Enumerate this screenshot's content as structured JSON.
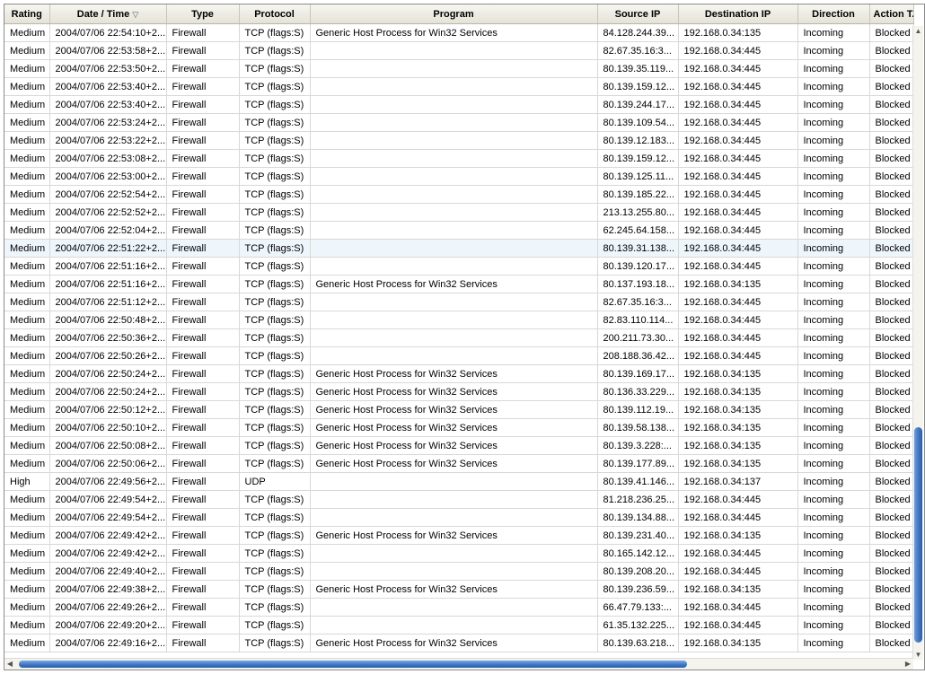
{
  "columns": [
    {
      "key": "rating",
      "label": "Rating"
    },
    {
      "key": "datetime",
      "label": "Date / Time",
      "sort": "▽"
    },
    {
      "key": "type",
      "label": "Type"
    },
    {
      "key": "protocol",
      "label": "Protocol"
    },
    {
      "key": "program",
      "label": "Program"
    },
    {
      "key": "source_ip",
      "label": "Source IP"
    },
    {
      "key": "dest_ip",
      "label": "Destination IP"
    },
    {
      "key": "direction",
      "label": "Direction"
    },
    {
      "key": "action",
      "label": "Action T..."
    }
  ],
  "rows": [
    [
      "Medium",
      "2004/07/06 22:54:10+2...",
      "Firewall",
      "TCP (flags:S)",
      "Generic Host Process for Win32 Services",
      "84.128.244.39...",
      "192.168.0.34:135",
      "Incoming",
      "Blocked"
    ],
    [
      "Medium",
      "2004/07/06 22:53:58+2...",
      "Firewall",
      "TCP (flags:S)",
      "",
      "82.67.35.16:3...",
      "192.168.0.34:445",
      "Incoming",
      "Blocked"
    ],
    [
      "Medium",
      "2004/07/06 22:53:50+2...",
      "Firewall",
      "TCP (flags:S)",
      "",
      "80.139.35.119...",
      "192.168.0.34:445",
      "Incoming",
      "Blocked"
    ],
    [
      "Medium",
      "2004/07/06 22:53:40+2...",
      "Firewall",
      "TCP (flags:S)",
      "",
      "80.139.159.12...",
      "192.168.0.34:445",
      "Incoming",
      "Blocked"
    ],
    [
      "Medium",
      "2004/07/06 22:53:40+2...",
      "Firewall",
      "TCP (flags:S)",
      "",
      "80.139.244.17...",
      "192.168.0.34:445",
      "Incoming",
      "Blocked"
    ],
    [
      "Medium",
      "2004/07/06 22:53:24+2...",
      "Firewall",
      "TCP (flags:S)",
      "",
      "80.139.109.54...",
      "192.168.0.34:445",
      "Incoming",
      "Blocked"
    ],
    [
      "Medium",
      "2004/07/06 22:53:22+2...",
      "Firewall",
      "TCP (flags:S)",
      "",
      "80.139.12.183...",
      "192.168.0.34:445",
      "Incoming",
      "Blocked"
    ],
    [
      "Medium",
      "2004/07/06 22:53:08+2...",
      "Firewall",
      "TCP (flags:S)",
      "",
      "80.139.159.12...",
      "192.168.0.34:445",
      "Incoming",
      "Blocked"
    ],
    [
      "Medium",
      "2004/07/06 22:53:00+2...",
      "Firewall",
      "TCP (flags:S)",
      "",
      "80.139.125.11...",
      "192.168.0.34:445",
      "Incoming",
      "Blocked"
    ],
    [
      "Medium",
      "2004/07/06 22:52:54+2...",
      "Firewall",
      "TCP (flags:S)",
      "",
      "80.139.185.22...",
      "192.168.0.34:445",
      "Incoming",
      "Blocked"
    ],
    [
      "Medium",
      "2004/07/06 22:52:52+2...",
      "Firewall",
      "TCP (flags:S)",
      "",
      "213.13.255.80...",
      "192.168.0.34:445",
      "Incoming",
      "Blocked"
    ],
    [
      "Medium",
      "2004/07/06 22:52:04+2...",
      "Firewall",
      "TCP (flags:S)",
      "",
      "62.245.64.158...",
      "192.168.0.34:445",
      "Incoming",
      "Blocked"
    ],
    [
      "Medium",
      "2004/07/06 22:51:22+2...",
      "Firewall",
      "TCP (flags:S)",
      "",
      "80.139.31.138...",
      "192.168.0.34:445",
      "Incoming",
      "Blocked"
    ],
    [
      "Medium",
      "2004/07/06 22:51:16+2...",
      "Firewall",
      "TCP (flags:S)",
      "",
      "80.139.120.17...",
      "192.168.0.34:445",
      "Incoming",
      "Blocked"
    ],
    [
      "Medium",
      "2004/07/06 22:51:16+2...",
      "Firewall",
      "TCP (flags:S)",
      "Generic Host Process for Win32 Services",
      "80.137.193.18...",
      "192.168.0.34:135",
      "Incoming",
      "Blocked"
    ],
    [
      "Medium",
      "2004/07/06 22:51:12+2...",
      "Firewall",
      "TCP (flags:S)",
      "",
      "82.67.35.16:3...",
      "192.168.0.34:445",
      "Incoming",
      "Blocked"
    ],
    [
      "Medium",
      "2004/07/06 22:50:48+2...",
      "Firewall",
      "TCP (flags:S)",
      "",
      "82.83.110.114...",
      "192.168.0.34:445",
      "Incoming",
      "Blocked"
    ],
    [
      "Medium",
      "2004/07/06 22:50:36+2...",
      "Firewall",
      "TCP (flags:S)",
      "",
      "200.211.73.30...",
      "192.168.0.34:445",
      "Incoming",
      "Blocked"
    ],
    [
      "Medium",
      "2004/07/06 22:50:26+2...",
      "Firewall",
      "TCP (flags:S)",
      "",
      "208.188.36.42...",
      "192.168.0.34:445",
      "Incoming",
      "Blocked"
    ],
    [
      "Medium",
      "2004/07/06 22:50:24+2...",
      "Firewall",
      "TCP (flags:S)",
      "Generic Host Process for Win32 Services",
      "80.139.169.17...",
      "192.168.0.34:135",
      "Incoming",
      "Blocked"
    ],
    [
      "Medium",
      "2004/07/06 22:50:24+2...",
      "Firewall",
      "TCP (flags:S)",
      "Generic Host Process for Win32 Services",
      "80.136.33.229...",
      "192.168.0.34:135",
      "Incoming",
      "Blocked"
    ],
    [
      "Medium",
      "2004/07/06 22:50:12+2...",
      "Firewall",
      "TCP (flags:S)",
      "Generic Host Process for Win32 Services",
      "80.139.112.19...",
      "192.168.0.34:135",
      "Incoming",
      "Blocked"
    ],
    [
      "Medium",
      "2004/07/06 22:50:10+2...",
      "Firewall",
      "TCP (flags:S)",
      "Generic Host Process for Win32 Services",
      "80.139.58.138...",
      "192.168.0.34:135",
      "Incoming",
      "Blocked"
    ],
    [
      "Medium",
      "2004/07/06 22:50:08+2...",
      "Firewall",
      "TCP (flags:S)",
      "Generic Host Process for Win32 Services",
      "80.139.3.228:...",
      "192.168.0.34:135",
      "Incoming",
      "Blocked"
    ],
    [
      "Medium",
      "2004/07/06 22:50:06+2...",
      "Firewall",
      "TCP (flags:S)",
      "Generic Host Process for Win32 Services",
      "80.139.177.89...",
      "192.168.0.34:135",
      "Incoming",
      "Blocked"
    ],
    [
      "High",
      "2004/07/06 22:49:56+2...",
      "Firewall",
      "UDP",
      "",
      "80.139.41.146...",
      "192.168.0.34:137",
      "Incoming",
      "Blocked"
    ],
    [
      "Medium",
      "2004/07/06 22:49:54+2...",
      "Firewall",
      "TCP (flags:S)",
      "",
      "81.218.236.25...",
      "192.168.0.34:445",
      "Incoming",
      "Blocked"
    ],
    [
      "Medium",
      "2004/07/06 22:49:54+2...",
      "Firewall",
      "TCP (flags:S)",
      "",
      "80.139.134.88...",
      "192.168.0.34:445",
      "Incoming",
      "Blocked"
    ],
    [
      "Medium",
      "2004/07/06 22:49:42+2...",
      "Firewall",
      "TCP (flags:S)",
      "Generic Host Process for Win32 Services",
      "80.139.231.40...",
      "192.168.0.34:135",
      "Incoming",
      "Blocked"
    ],
    [
      "Medium",
      "2004/07/06 22:49:42+2...",
      "Firewall",
      "TCP (flags:S)",
      "",
      "80.165.142.12...",
      "192.168.0.34:445",
      "Incoming",
      "Blocked"
    ],
    [
      "Medium",
      "2004/07/06 22:49:40+2...",
      "Firewall",
      "TCP (flags:S)",
      "",
      "80.139.208.20...",
      "192.168.0.34:445",
      "Incoming",
      "Blocked"
    ],
    [
      "Medium",
      "2004/07/06 22:49:38+2...",
      "Firewall",
      "TCP (flags:S)",
      "Generic Host Process for Win32 Services",
      "80.139.236.59...",
      "192.168.0.34:135",
      "Incoming",
      "Blocked"
    ],
    [
      "Medium",
      "2004/07/06 22:49:26+2...",
      "Firewall",
      "TCP (flags:S)",
      "",
      "66.47.79.133:...",
      "192.168.0.34:445",
      "Incoming",
      "Blocked"
    ],
    [
      "Medium",
      "2004/07/06 22:49:20+2...",
      "Firewall",
      "TCP (flags:S)",
      "",
      "61.35.132.225...",
      "192.168.0.34:445",
      "Incoming",
      "Blocked"
    ],
    [
      "Medium",
      "2004/07/06 22:49:16+2...",
      "Firewall",
      "TCP (flags:S)",
      "Generic Host Process for Win32 Services",
      "80.139.63.218...",
      "192.168.0.34:135",
      "Incoming",
      "Blocked"
    ]
  ],
  "highlighted_row": 12,
  "scrollbars": {
    "vertical": {
      "up_icon": "up-arrow-icon",
      "down_icon": "down-arrow-icon"
    },
    "horizontal": {
      "left_icon": "left-arrow-icon",
      "right_icon": "right-arrow-icon"
    }
  },
  "colors": {
    "thumb": "#3c73c2",
    "highlight": "#eef6fc",
    "header_bg": "#ece9d8"
  }
}
